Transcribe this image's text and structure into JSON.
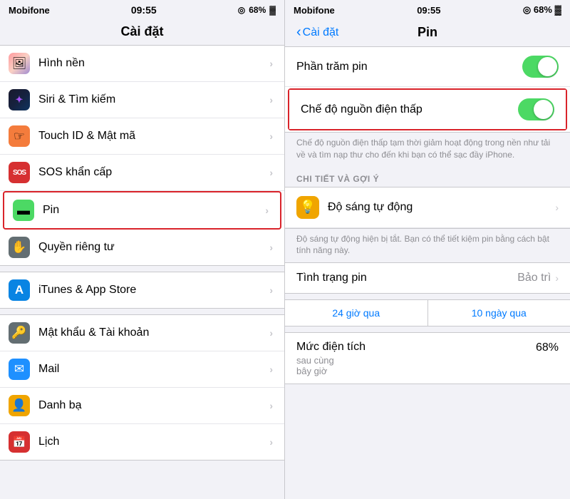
{
  "left": {
    "status": {
      "carrier": "Mobifone",
      "time": "09:55",
      "battery": "68%",
      "battery_icon": "🔋"
    },
    "title": "Cài đặt",
    "items": [
      {
        "id": "wallpaper",
        "label": "Hình nền",
        "icon": "🖼",
        "icon_class": "icon-wallpaper",
        "highlighted": false
      },
      {
        "id": "siri",
        "label": "Siri & Tìm kiếm",
        "icon": "✦",
        "icon_class": "icon-siri",
        "highlighted": false
      },
      {
        "id": "touchid",
        "label": "Touch ID & Mật mã",
        "icon": "👆",
        "icon_class": "icon-touchid",
        "highlighted": false
      },
      {
        "id": "sos",
        "label": "SOS khẩn cấp",
        "icon": "SOS",
        "icon_class": "icon-sos",
        "highlighted": false
      },
      {
        "id": "battery",
        "label": "Pin",
        "icon": "🔋",
        "icon_class": "icon-battery",
        "highlighted": true
      },
      {
        "id": "privacy",
        "label": "Quyền riêng tư",
        "icon": "✋",
        "icon_class": "icon-privacy",
        "highlighted": false
      },
      {
        "id": "itunes",
        "label": "iTunes & App Store",
        "icon": "A",
        "icon_class": "icon-itunes",
        "highlighted": false
      },
      {
        "id": "password",
        "label": "Mật khẩu & Tài khoản",
        "icon": "🔑",
        "icon_class": "icon-password",
        "highlighted": false
      },
      {
        "id": "mail",
        "label": "Mail",
        "icon": "✉",
        "icon_class": "icon-mail",
        "highlighted": false
      },
      {
        "id": "contacts",
        "label": "Danh bạ",
        "icon": "👤",
        "icon_class": "icon-contacts",
        "highlighted": false
      },
      {
        "id": "calendar",
        "label": "Lịch",
        "icon": "📅",
        "icon_class": "icon-calendar",
        "highlighted": false
      }
    ]
  },
  "right": {
    "status": {
      "carrier": "Mobifone",
      "time": "09:55",
      "battery": "68%"
    },
    "back_label": "Cài đặt",
    "title": "Pin",
    "rows": [
      {
        "id": "phantram",
        "label": "Phần trăm pin",
        "toggle": true,
        "toggle_on": true,
        "highlighted": false
      },
      {
        "id": "chedonguon",
        "label": "Chế độ nguồn điện thấp",
        "toggle": true,
        "toggle_on": true,
        "highlighted": true
      }
    ],
    "note": "Chế độ nguồn điện thấp tạm thời giảm hoạt động trong nền như tải về và tìm nạp thư cho đến khi bạn có thể sạc đầy iPhone.",
    "section_header": "CHI TIẾT VÀ GỢI Ý",
    "brightness": {
      "label": "Độ sáng tự động",
      "note": "Độ sáng tự động hiện bị tắt. Bạn có thể tiết kiệm pin bằng cách bật tính năng này."
    },
    "tinh_trang": {
      "label": "Tình trạng pin",
      "value": "Bảo trì"
    },
    "tabs": [
      {
        "id": "24h",
        "label": "24 giờ qua"
      },
      {
        "id": "10d",
        "label": "10 ngày qua"
      }
    ],
    "muc_dien": {
      "title": "Mức điện tích",
      "sub": "sau cùng",
      "sub2": "bây giờ",
      "value": "68%"
    }
  }
}
